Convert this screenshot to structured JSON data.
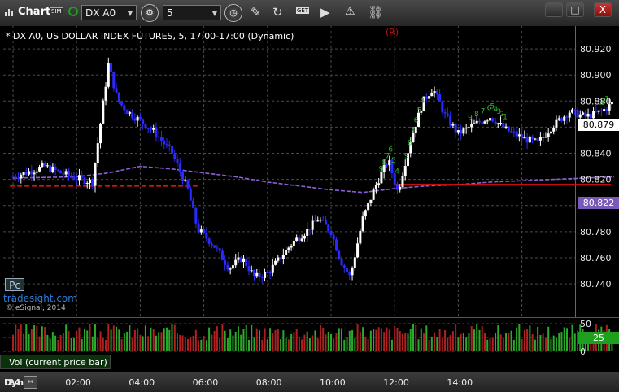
{
  "toolbar": {
    "app_title": "Chart",
    "sim_badge": "SIM",
    "symbol": "DX A0",
    "interval": "5",
    "news_badge": "GET",
    "window_minimize": "_",
    "window_maximize": "□",
    "window_close": "X"
  },
  "chart": {
    "title": "* DX A0, US DOLLAR INDEX FUTURES, 5, 17:00-17:00 (Dynamic)",
    "marker": "(R)",
    "pc_badge": "Pc",
    "watermark": "tradesight.com",
    "copyright": "© eSignal, 2014",
    "last_price": "80.879",
    "ma_value": "80.822",
    "colors": {
      "background": "#000000",
      "grid": "#4a4a4a",
      "up_bar": "#ffffff",
      "down_bar": "#2a2aff",
      "moving_average": "#8c5fd6",
      "level_line": "#e01010",
      "sequential_count": "#2fb82f",
      "vol_up": "#2aaa2a",
      "vol_down": "#b02020",
      "last_price_tag_bg": "#ffffff",
      "ma_tag_bg": "#7a5ab8"
    },
    "y_axis": [
      "80.920",
      "80.900",
      "80.880",
      "80.860",
      "80.840",
      "80.820",
      "80.800",
      "80.780",
      "80.760",
      "80.740"
    ],
    "sequential_labels": [
      "9",
      "8",
      "7",
      "6",
      "5",
      "4",
      "9",
      "8",
      "7",
      "6",
      "5",
      "4",
      "9",
      "8",
      "7",
      "6",
      "5",
      "4",
      "3",
      "2",
      "1",
      "3",
      "2",
      "1"
    ]
  },
  "volume": {
    "label": "Vol (current price bar)",
    "y_axis": [
      "50",
      "25",
      "0"
    ],
    "current_value": "25"
  },
  "timebar": {
    "mode": "Dyn",
    "labels": [
      "24",
      "02:00",
      "04:00",
      "06:00",
      "08:00",
      "10:00",
      "12:00",
      "14:00"
    ]
  },
  "chart_data": {
    "type": "candlestick",
    "title": "* DX A0, US DOLLAR INDEX FUTURES, 5, 17:00-17:00 (Dynamic)",
    "x_ticks": [
      "24",
      "02:00",
      "04:00",
      "06:00",
      "08:00",
      "10:00",
      "12:00",
      "14:00"
    ],
    "y_ticks": [
      80.92,
      80.9,
      80.88,
      80.86,
      80.84,
      80.82,
      80.8,
      80.78,
      80.76,
      80.74
    ],
    "ylim": [
      80.722,
      80.935
    ],
    "grid": true,
    "series": [
      {
        "name": "Price",
        "points": [
          [
            0,
            80.822
          ],
          [
            0.5,
            80.826
          ],
          [
            1,
            80.83
          ],
          [
            1.5,
            80.825
          ],
          [
            2,
            80.821
          ],
          [
            2.5,
            80.818
          ],
          [
            3,
            80.908
          ],
          [
            3.3,
            80.88
          ],
          [
            3.6,
            80.872
          ],
          [
            4,
            80.865
          ],
          [
            4.5,
            80.855
          ],
          [
            5,
            80.84
          ],
          [
            5.5,
            80.812
          ],
          [
            5.8,
            80.782
          ],
          [
            6.3,
            80.77
          ],
          [
            6.8,
            80.752
          ],
          [
            7.2,
            80.76
          ],
          [
            7.6,
            80.745
          ],
          [
            8,
            80.748
          ],
          [
            8.4,
            80.76
          ],
          [
            8.8,
            80.772
          ],
          [
            9.2,
            80.78
          ],
          [
            9.6,
            80.79
          ],
          [
            10,
            80.78
          ],
          [
            10.3,
            80.758
          ],
          [
            10.6,
            80.745
          ],
          [
            11,
            80.79
          ],
          [
            11.4,
            80.815
          ],
          [
            11.8,
            80.835
          ],
          [
            12.1,
            80.81
          ],
          [
            12.5,
            80.85
          ],
          [
            12.9,
            80.88
          ],
          [
            13.2,
            80.89
          ],
          [
            13.6,
            80.868
          ],
          [
            14,
            80.855
          ],
          [
            14.5,
            80.862
          ],
          [
            15,
            80.868
          ],
          [
            15.5,
            80.858
          ],
          [
            16,
            80.852
          ],
          [
            16.5,
            80.848
          ],
          [
            17,
            80.862
          ],
          [
            17.5,
            80.872
          ],
          [
            18,
            80.868
          ],
          [
            18.5,
            80.872
          ],
          [
            18.9,
            80.879
          ]
        ]
      },
      {
        "name": "Moving Average",
        "points": [
          [
            0,
            80.821
          ],
          [
            2,
            80.822
          ],
          [
            3,
            80.825
          ],
          [
            4,
            80.83
          ],
          [
            5,
            80.828
          ],
          [
            6,
            80.825
          ],
          [
            7,
            80.822
          ],
          [
            8,
            80.818
          ],
          [
            9,
            80.815
          ],
          [
            10,
            80.812
          ],
          [
            11,
            80.81
          ],
          [
            12,
            80.813
          ],
          [
            13,
            80.815
          ],
          [
            14,
            80.816
          ],
          [
            15,
            80.818
          ],
          [
            16,
            80.819
          ],
          [
            17,
            80.82
          ],
          [
            18,
            80.821
          ],
          [
            18.9,
            80.822
          ]
        ]
      }
    ],
    "levels": [
      {
        "value": 80.815,
        "from_hour": -0.1,
        "to_hour": 5.8,
        "style": "dashed"
      },
      {
        "value": 80.816,
        "from_hour": 12.0,
        "to_hour": 18.8,
        "style": "solid"
      }
    ]
  }
}
